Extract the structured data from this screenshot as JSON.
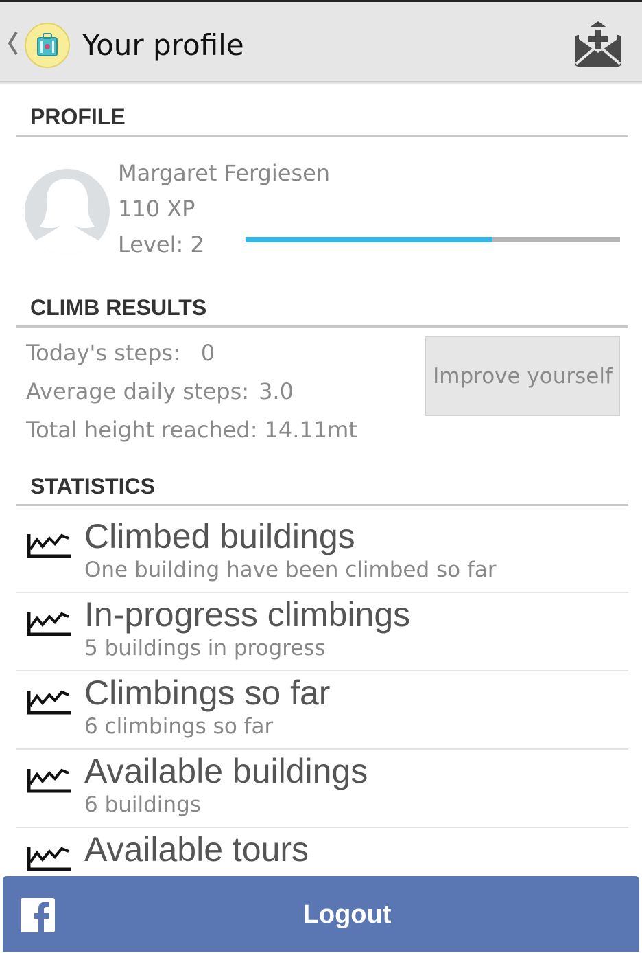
{
  "action_bar": {
    "title": "Your profile"
  },
  "colors": {
    "accent": "#33b5e5",
    "facebook": "#5b77b3",
    "action_bar_bg": "#e6e6e6"
  },
  "sections": {
    "profile": "PROFILE",
    "climb_results": "CLIMB RESULTS",
    "statistics": "STATISTICS"
  },
  "profile": {
    "name": "Margaret Fergiesen",
    "xp": "110 XP",
    "level": "Level: 2",
    "xp_progress": 0.66
  },
  "climb": {
    "todays_steps_label": "Today's steps:",
    "todays_steps_value": "0",
    "avg_steps_label": "Average daily steps:",
    "avg_steps_value": "3.0",
    "total_height_label": "Total height reached:",
    "total_height_value": "14.11mt",
    "improve_button": "Improve yourself"
  },
  "statistics": [
    {
      "title": "Climbed buildings",
      "subtitle": "One building have been climbed so far",
      "icon": "line-chart-icon"
    },
    {
      "title": "In-progress climbings",
      "subtitle": "5 buildings in progress",
      "icon": "line-chart-icon"
    },
    {
      "title": "Climbings so far",
      "subtitle": "6 climbings so far",
      "icon": "line-chart-icon"
    },
    {
      "title": "Available buildings",
      "subtitle": "6 buildings",
      "icon": "line-chart-icon"
    },
    {
      "title": "Available tours",
      "subtitle": "",
      "icon": "line-chart-icon"
    }
  ],
  "logout": {
    "label": "Logout",
    "icon": "facebook-icon"
  }
}
